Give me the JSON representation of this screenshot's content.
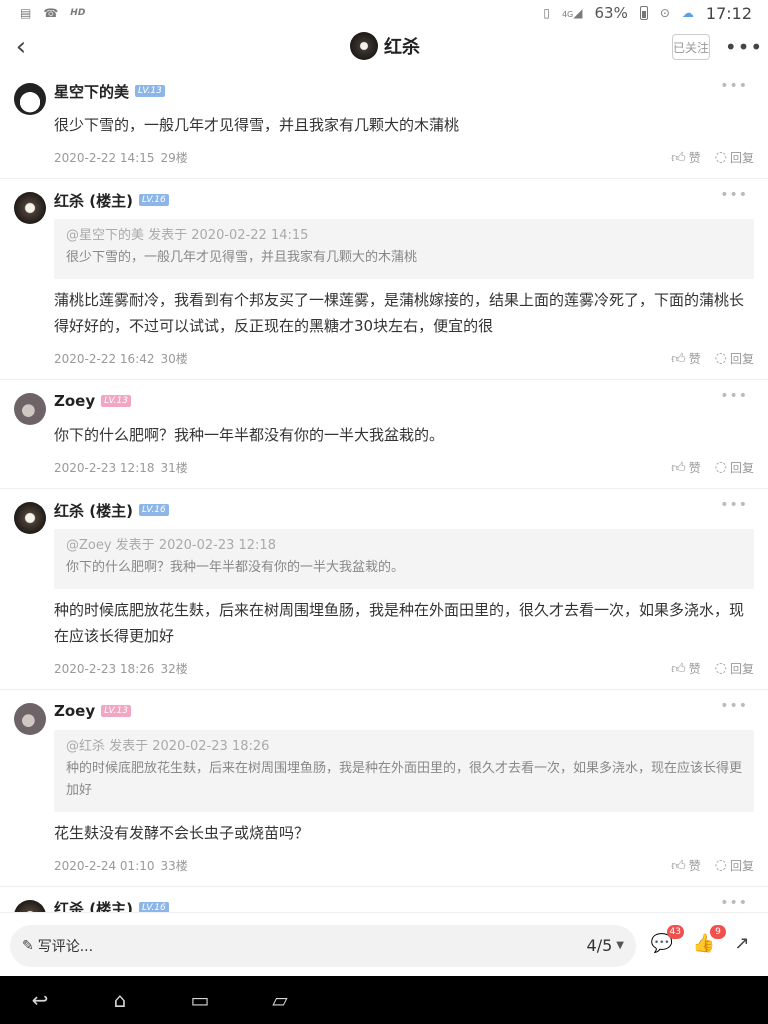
{
  "status_bar": {
    "battery": "63%",
    "time": "17:12",
    "hd": "HD",
    "network": "4G",
    "left_icons": [
      "message-icon",
      "missed-call-icon",
      "hd-icon"
    ],
    "right_icons": [
      "vibrate-icon",
      "signal-4g-icon",
      "battery-icon",
      "alarm-icon",
      "cloud-icon"
    ]
  },
  "nav": {
    "title": "红杀",
    "follow_label": "已关注",
    "back_icon": "back-icon",
    "more_icon": "more-icon"
  },
  "comments": [
    {
      "user": "星空下的美",
      "level": "LV.13",
      "level_color": "#8cb6e8",
      "avatar": "girl",
      "body": "很少下雪的，一般几年才见得雪，并且我家有几颗大的木蒲桃",
      "time": "2020-2-22 14:15",
      "floor": "29楼",
      "like_label": "赞",
      "reply_label": "回复"
    },
    {
      "user": "红杀 (楼主)",
      "level": "LV.16",
      "level_color": "#8cb6e8",
      "avatar": "flower",
      "quote_head": "@星空下的美 发表于 2020-02-22 14:15",
      "quote_text": "很少下雪的，一般几年才见得雪，并且我家有几颗大的木蒲桃",
      "body": "蒲桃比莲雾耐冷，我看到有个邦友买了一棵莲雾，是蒲桃嫁接的，结果上面的莲雾冷死了，下面的蒲桃长得好好的，不过可以试试，反正现在的黑糖才30块左右，便宜的很",
      "time": "2020-2-22 16:42",
      "floor": "30楼",
      "like_label": "赞",
      "reply_label": "回复"
    },
    {
      "user": "Zoey",
      "level": "LV.13",
      "level_color": "#f3a6c4",
      "avatar": "zoey",
      "body": "你下的什么肥啊？我种一年半都没有你的一半大我盆栽的。",
      "time": "2020-2-23 12:18",
      "floor": "31楼",
      "like_label": "赞",
      "reply_label": "回复"
    },
    {
      "user": "红杀 (楼主)",
      "level": "LV.16",
      "level_color": "#8cb6e8",
      "avatar": "flower",
      "quote_head": "@Zoey 发表于 2020-02-23 12:18",
      "quote_text": "你下的什么肥啊？我种一年半都没有你的一半大我盆栽的。",
      "body": "种的时候底肥放花生麸，后来在树周围埋鱼肠，我是种在外面田里的，很久才去看一次，如果多浇水，现在应该长得更加好",
      "time": "2020-2-23 18:26",
      "floor": "32楼",
      "like_label": "赞",
      "reply_label": "回复"
    },
    {
      "user": "Zoey",
      "level": "LV.13",
      "level_color": "#f3a6c4",
      "avatar": "zoey",
      "quote_head": "@红杀 发表于 2020-02-23 18:26",
      "quote_text": "种的时候底肥放花生麸，后来在树周围埋鱼肠，我是种在外面田里的，很久才去看一次，如果多浇水，现在应该长得更加好",
      "body": "花生麸没有发酵不会长虫子或烧苗吗？",
      "time": "2020-2-24 01:10",
      "floor": "33楼",
      "like_label": "赞",
      "reply_label": "回复"
    },
    {
      "user": "红杀 (楼主)",
      "level": "LV.16",
      "level_color": "#8cb6e8",
      "avatar": "flower"
    }
  ],
  "bottom": {
    "placeholder": "写评论...",
    "page": "4/5",
    "comment_count": "43",
    "like_count": "9",
    "icons": [
      "pen-icon",
      "comment-icon",
      "like-icon",
      "share-icon"
    ]
  },
  "system_nav": {
    "icons": [
      "back-nav-icon",
      "home-nav-icon",
      "recents-nav-icon",
      "screenshot-nav-icon"
    ]
  }
}
